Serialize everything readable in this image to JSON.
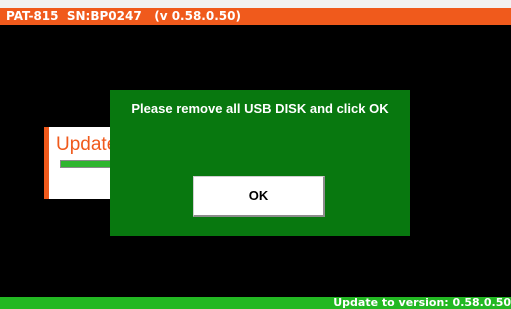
{
  "header": {
    "title": "PAT-815  SN:BP0247   (v 0.58.0.50)"
  },
  "update_panel": {
    "title": "Update",
    "progress": 1.0
  },
  "dialog": {
    "message": "Please remove all USB DISK and click OK",
    "ok_label": "OK"
  },
  "status_bar": {
    "text": "Update to version: 0.58.0.50"
  },
  "colors": {
    "header_bg": "#f05a1c",
    "dialog_bg": "#08780f",
    "status_bg": "#22b822",
    "screen_bg": "#000000"
  }
}
